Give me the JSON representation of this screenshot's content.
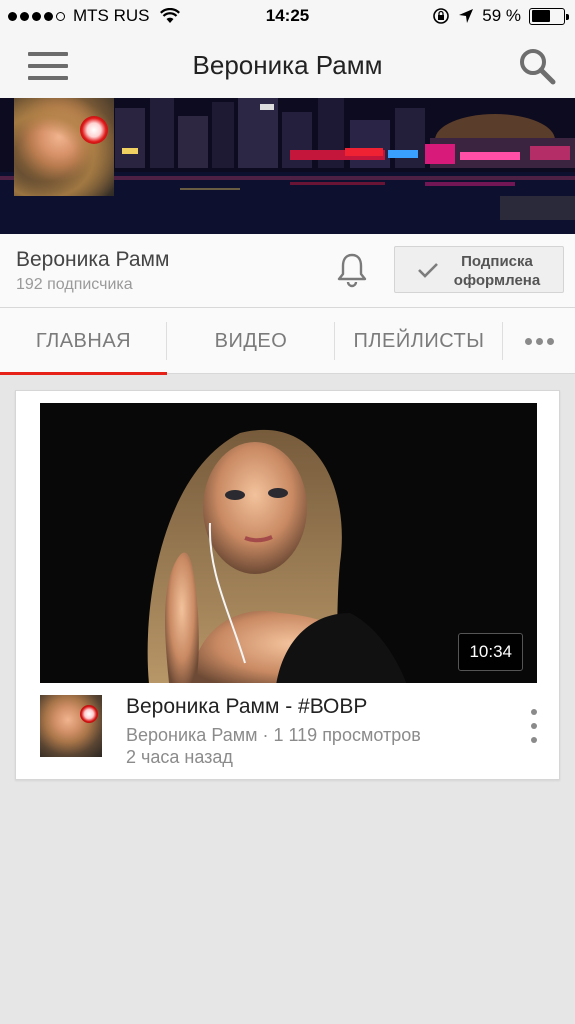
{
  "status_bar": {
    "carrier": "MTS RUS",
    "time": "14:25",
    "battery_percent": "59 %",
    "battery_level": 0.59,
    "signal_bars_filled": 4,
    "signal_bars_total": 5
  },
  "app_bar": {
    "title": "Вероника Рамм",
    "menu_icon": "hamburger-menu-icon",
    "search_icon": "search-icon"
  },
  "channel": {
    "name": "Вероника Рамм",
    "subscribers": "192 подписчика",
    "subscribe_label": "Подписка оформлена",
    "bell_icon": "bell-icon",
    "check_icon": "checkmark-icon"
  },
  "tabs": [
    {
      "label": "ГЛАВНАЯ",
      "active": true
    },
    {
      "label": "ВИДЕО",
      "active": false
    },
    {
      "label": "ПЛЕЙЛИСТЫ",
      "active": false
    }
  ],
  "video": {
    "duration": "10:34",
    "title": "Вероника Рамм - #ВОВР",
    "meta": "Вероника Рамм · 1 119 просмотров",
    "age": "2 часа назад"
  },
  "colors": {
    "accent": "#e62117",
    "bar_background": "#f6f6f6",
    "page_background": "#e6e6e6"
  }
}
